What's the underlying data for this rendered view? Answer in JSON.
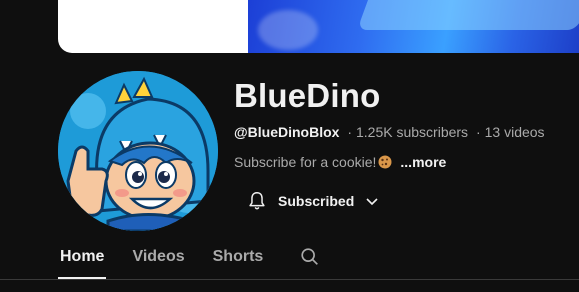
{
  "channel": {
    "name": "BlueDino",
    "handle": "@BlueDinoBlox",
    "subscribers": "1.25K subscribers",
    "videos": "13 videos",
    "separator": "·",
    "description": "Subscribe for a cookie!",
    "more_label": "...more"
  },
  "subscribe_button": {
    "label": "Subscribed",
    "icons": [
      "bell-icon",
      "chevron-down-icon"
    ]
  },
  "tabs": [
    {
      "label": "Home",
      "active": true
    },
    {
      "label": "Videos",
      "active": false
    },
    {
      "label": "Shorts",
      "active": false
    }
  ],
  "colors": {
    "background": "#0f0f0f",
    "primary_text": "#f1f1f1",
    "secondary_text": "#aaaaaa",
    "avatar_blue": "#1e9bd8"
  }
}
